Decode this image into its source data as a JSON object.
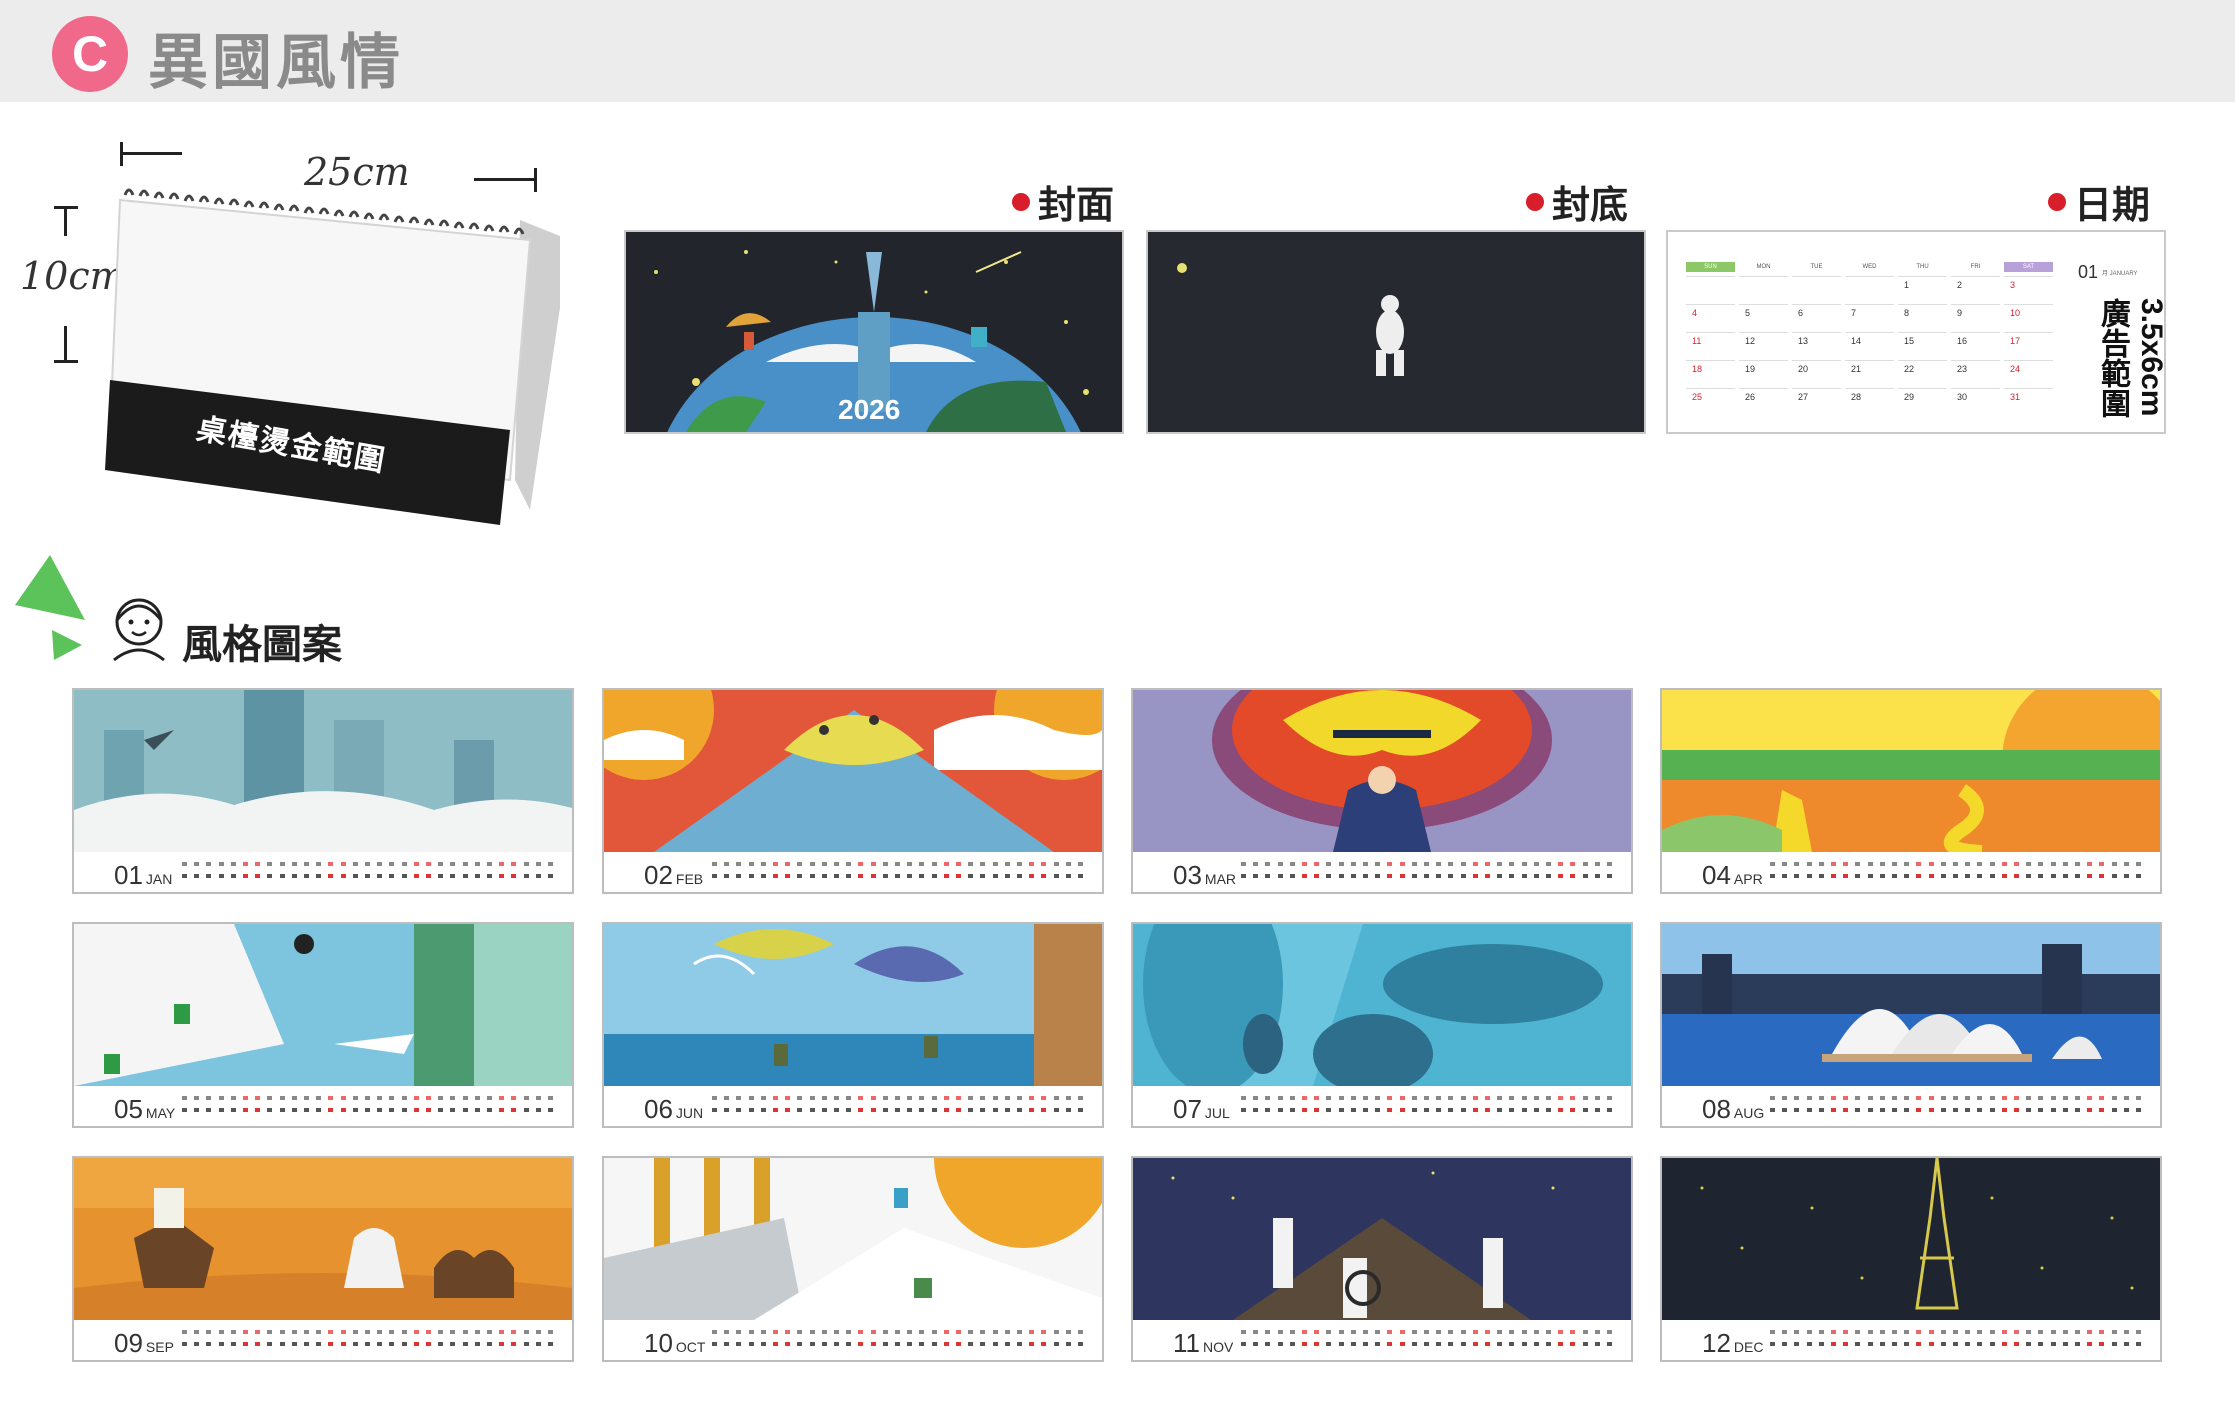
{
  "header": {
    "badge": "C",
    "title": "異國風情"
  },
  "dimensions": {
    "width_label": "25cm",
    "height_label": "10cm",
    "imprint_label": "桌檯燙金範圍"
  },
  "previews": {
    "front_label": "封面",
    "back_label": "封底",
    "date_label": "日期",
    "cover_year": "2026",
    "ad_area": "3.5x6cm廣告範圍"
  },
  "date_preview": {
    "month_num": "01",
    "month_text": "月 JANUARY",
    "weekdays": [
      "SUN",
      "MON",
      "TUE",
      "WED",
      "THU",
      "FRI",
      "SAT"
    ],
    "rows": [
      [
        "",
        "",
        "",
        "",
        "1",
        "2",
        "3"
      ],
      [
        "4",
        "5",
        "6",
        "7",
        "8",
        "9",
        "10"
      ],
      [
        "11",
        "12",
        "13",
        "14",
        "15",
        "16",
        "17"
      ],
      [
        "18",
        "19",
        "20",
        "21",
        "22",
        "23",
        "24"
      ],
      [
        "25",
        "26",
        "27",
        "28",
        "29",
        "30",
        "31"
      ]
    ]
  },
  "style_section": {
    "title": "風格圖案"
  },
  "months": [
    {
      "num": "01",
      "abbr": "JAN"
    },
    {
      "num": "02",
      "abbr": "FEB"
    },
    {
      "num": "03",
      "abbr": "MAR"
    },
    {
      "num": "04",
      "abbr": "APR"
    },
    {
      "num": "05",
      "abbr": "MAY"
    },
    {
      "num": "06",
      "abbr": "JUN"
    },
    {
      "num": "07",
      "abbr": "JUL"
    },
    {
      "num": "08",
      "abbr": "AUG"
    },
    {
      "num": "09",
      "abbr": "SEP"
    },
    {
      "num": "10",
      "abbr": "OCT"
    },
    {
      "num": "11",
      "abbr": "NOV"
    },
    {
      "num": "12",
      "abbr": "DEC"
    }
  ],
  "colors": {
    "badge": "#f0698a",
    "dot": "#d81e2a",
    "triangle": "#5cc35a"
  }
}
